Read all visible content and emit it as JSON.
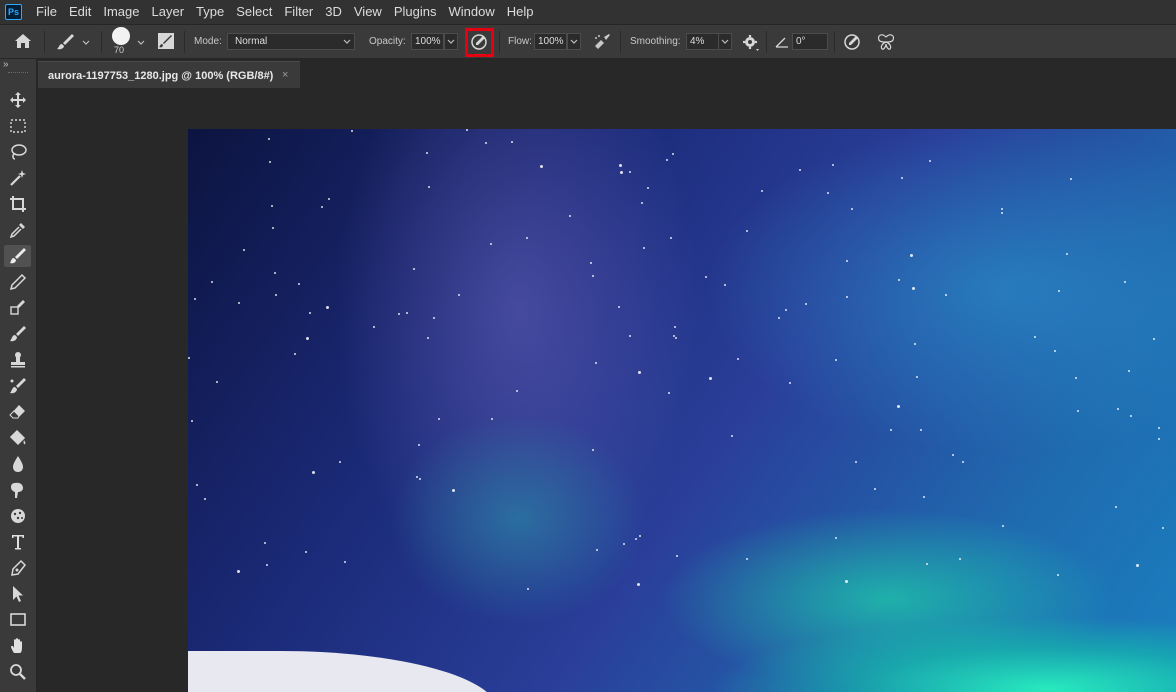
{
  "menu": [
    "File",
    "Edit",
    "Image",
    "Layer",
    "Type",
    "Select",
    "Filter",
    "3D",
    "View",
    "Plugins",
    "Window",
    "Help"
  ],
  "app_logo": "Ps",
  "options": {
    "brush_size": "70",
    "mode_label": "Mode:",
    "mode_value": "Normal",
    "opacity_label": "Opacity:",
    "opacity_value": "100%",
    "flow_label": "Flow:",
    "flow_value": "100%",
    "smoothing_label": "Smoothing:",
    "smoothing_value": "4%",
    "angle_value": "0°"
  },
  "document": {
    "tab_title": "aurora-1197753_1280.jpg @ 100% (RGB/8#)",
    "close_glyph": "×"
  },
  "panel_toggle": "»",
  "highlight_color": "#e60012",
  "tools": [
    "move-tool",
    "marquee-tool",
    "lasso-tool",
    "magic-wand-tool",
    "crop-tool",
    "eyedropper-tool",
    "brush-tool",
    "pencil-tool",
    "clone-stamp-tool",
    "history-brush-tool",
    "stamp-tool",
    "art-brush-tool",
    "eraser-tool",
    "paint-bucket-tool",
    "blur-tool",
    "smudge-tool",
    "sponge-tool",
    "type-tool",
    "pen-tool",
    "path-selection-tool",
    "rectangle-tool",
    "hand-tool",
    "zoom-tool"
  ],
  "active_tool": "brush-tool"
}
